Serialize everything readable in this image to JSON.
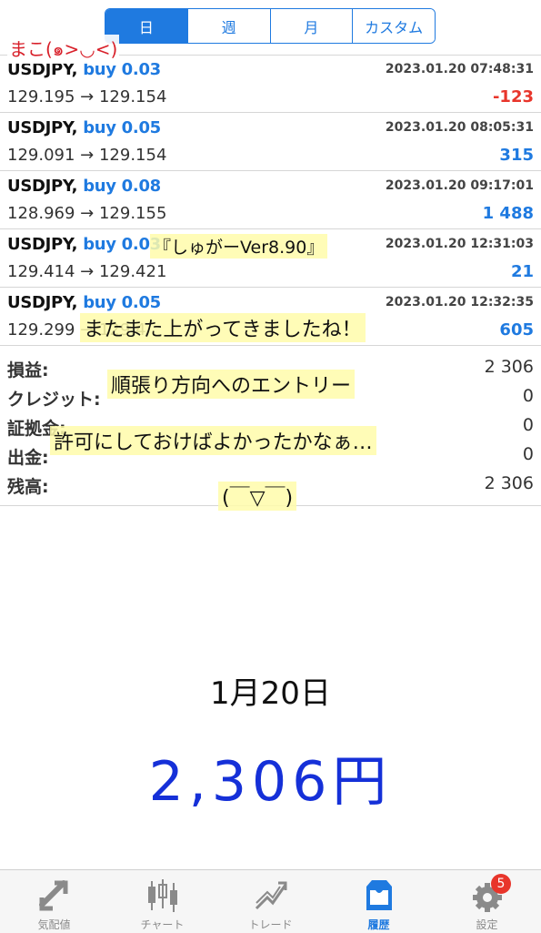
{
  "period_tabs": [
    "日",
    "週",
    "月",
    "カスタム"
  ],
  "active_period": "日",
  "author": "まこ(๑>◡<)",
  "trades": [
    {
      "symbol": "USDJPY,",
      "side": "buy 0.03",
      "time": "2023.01.20 07:48:31",
      "prices": "129.195 → 129.154",
      "profit": "-123",
      "profit_sign": "neg"
    },
    {
      "symbol": "USDJPY,",
      "side": "buy 0.05",
      "time": "2023.01.20 08:05:31",
      "prices": "129.091 → 129.154",
      "profit": "315",
      "profit_sign": "pos"
    },
    {
      "symbol": "USDJPY,",
      "side": "buy 0.08",
      "time": "2023.01.20 09:17:01",
      "prices": "128.969 → 129.155",
      "profit": "1 488",
      "profit_sign": "pos"
    },
    {
      "symbol": "USDJPY,",
      "side": "buy 0.03",
      "time": "2023.01.20 12:31:03",
      "prices": "129.414 → 129.421",
      "profit": "21",
      "profit_sign": "pos"
    },
    {
      "symbol": "USDJPY,",
      "side": "buy 0.05",
      "time": "2023.01.20 12:32:35",
      "prices": "129.299 → 129.4",
      "profit": "605",
      "profit_sign": "pos"
    }
  ],
  "summary": [
    {
      "label": "損益:",
      "value": "2 306"
    },
    {
      "label": "クレジット:",
      "value": "0"
    },
    {
      "label": "証拠金:",
      "value": "0"
    },
    {
      "label": "出金:",
      "value": "0"
    },
    {
      "label": "残高:",
      "value": "2 306"
    }
  ],
  "notes": {
    "version": "『しゅがーVer8.90』",
    "line1": "またまた上がってきましたね！",
    "line2": "順張り方向へのエントリー",
    "line3": "許可にしておけばよかったかなぁ…",
    "face": "(￣▽￣)"
  },
  "date_label": "1月20日",
  "big_amount": "2,306円",
  "tabs": [
    {
      "label": "気配値",
      "icon": "quotes-icon",
      "active": false
    },
    {
      "label": "チャート",
      "icon": "chart-icon",
      "active": false
    },
    {
      "label": "トレード",
      "icon": "trade-icon",
      "active": false
    },
    {
      "label": "履歴",
      "icon": "history-icon",
      "active": true
    },
    {
      "label": "設定",
      "icon": "settings-icon",
      "active": false
    }
  ],
  "settings_badge": "5",
  "colors": {
    "accent": "#1f7ae0",
    "loss": "#e8352b",
    "amount": "#1530d8"
  }
}
